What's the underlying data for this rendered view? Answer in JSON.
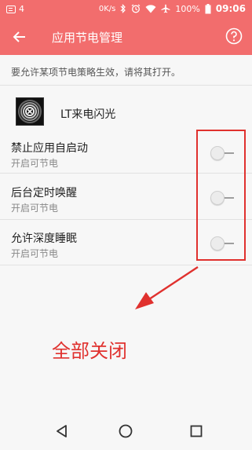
{
  "status_bar": {
    "notification_count": "4",
    "net_speed": "0K/s",
    "battery": "100%",
    "time": "09:06",
    "icons": [
      "notification-icon",
      "bluetooth-icon",
      "alarm-icon",
      "wifi-icon",
      "airplane-icon",
      "battery-icon"
    ]
  },
  "app_bar": {
    "title": "应用节电管理",
    "back_icon": "back-arrow-icon",
    "help_icon": "help-icon"
  },
  "hint": "要允许某项节电策略生效，请将其打开。",
  "app": {
    "name": "LT来电闪光",
    "icon": "app-icon"
  },
  "settings": [
    {
      "title": "禁止应用自启动",
      "subtitle": "开启可节电",
      "enabled": false
    },
    {
      "title": "后台定时唤醒",
      "subtitle": "开启可节电",
      "enabled": false
    },
    {
      "title": "允许深度睡眠",
      "subtitle": "开启可节电",
      "enabled": false
    }
  ],
  "annotation": {
    "text": "全部关闭",
    "color": "#e0312e"
  },
  "colors": {
    "accent": "#f26d6d",
    "annotation": "#e0312e"
  },
  "nav_bar": {
    "icons": [
      "nav-back-icon",
      "nav-home-icon",
      "nav-recents-icon"
    ]
  }
}
